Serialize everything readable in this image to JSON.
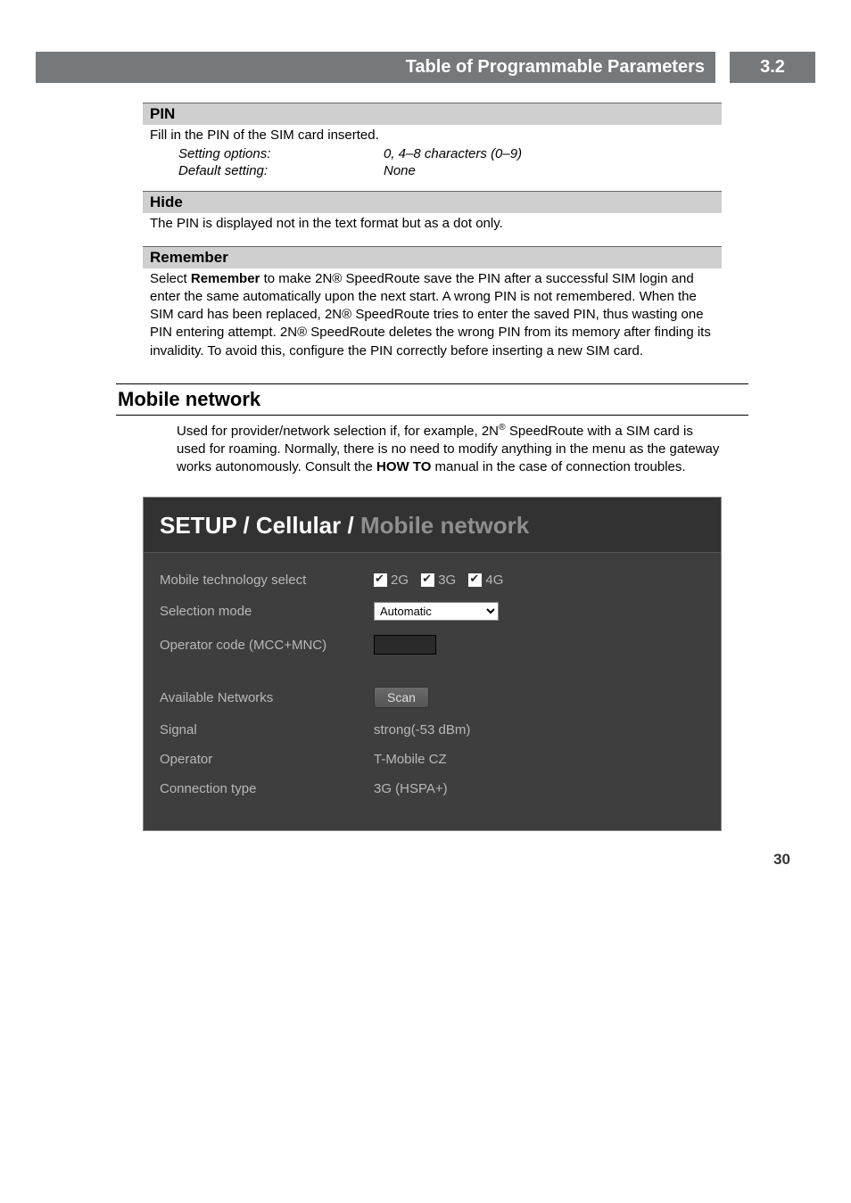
{
  "page": {
    "header_title": "Table of Programmable Parameters",
    "header_num": "3.2",
    "page_number": "30"
  },
  "pin": {
    "heading": "PIN",
    "text": "Fill in the PIN of the SIM card inserted.",
    "setting_label": "Setting options:",
    "setting_value": "0, 4–8 characters (0–9)",
    "default_label": "Default setting:",
    "default_value": "None"
  },
  "hide": {
    "heading": "Hide",
    "text": "The PIN is displayed not in the text format but as a dot only."
  },
  "remember": {
    "heading": "Remember",
    "text_a": "Select ",
    "text_bold": "Remember",
    "text_b": " to make 2N® SpeedRoute save the PIN after a successful SIM login and enter the same automatically upon the next start.  A wrong PIN is not remembered. When the SIM card has been replaced, 2N® SpeedRoute tries to enter the saved PIN, thus wasting one PIN entering attempt. 2N® SpeedRoute deletes the wrong PIN from its memory after finding its invalidity. To avoid this, configure the PIN correctly before inserting a new SIM card."
  },
  "mobile": {
    "heading": "Mobile network",
    "text_a": "Used for provider/network selection if, for example, 2N",
    "text_sup": "®",
    "text_b": " SpeedRoute with a SIM card is used for roaming. Normally, there is no need to modify anything in the menu as the gateway works autonomously. Consult the ",
    "text_bold": "HOW TO",
    "text_c": " manual in the case of connection troubles."
  },
  "ss": {
    "crumb_a": "SETUP / Cellular / ",
    "crumb_b": "Mobile network",
    "rows": {
      "tech_label": "Mobile technology select",
      "tech_2g": "2G",
      "tech_3g": "3G",
      "tech_4g": "4G",
      "mode_label": "Selection mode",
      "mode_value": "Automatic",
      "op_label": "Operator code (MCC+MNC)",
      "avail_label": "Available Networks",
      "scan": "Scan",
      "signal_label": "Signal",
      "signal_value": "strong(-53 dBm)",
      "operator_label": "Operator",
      "operator_value": "T-Mobile CZ",
      "conn_label": "Connection type",
      "conn_value": "3G (HSPA+)"
    }
  }
}
